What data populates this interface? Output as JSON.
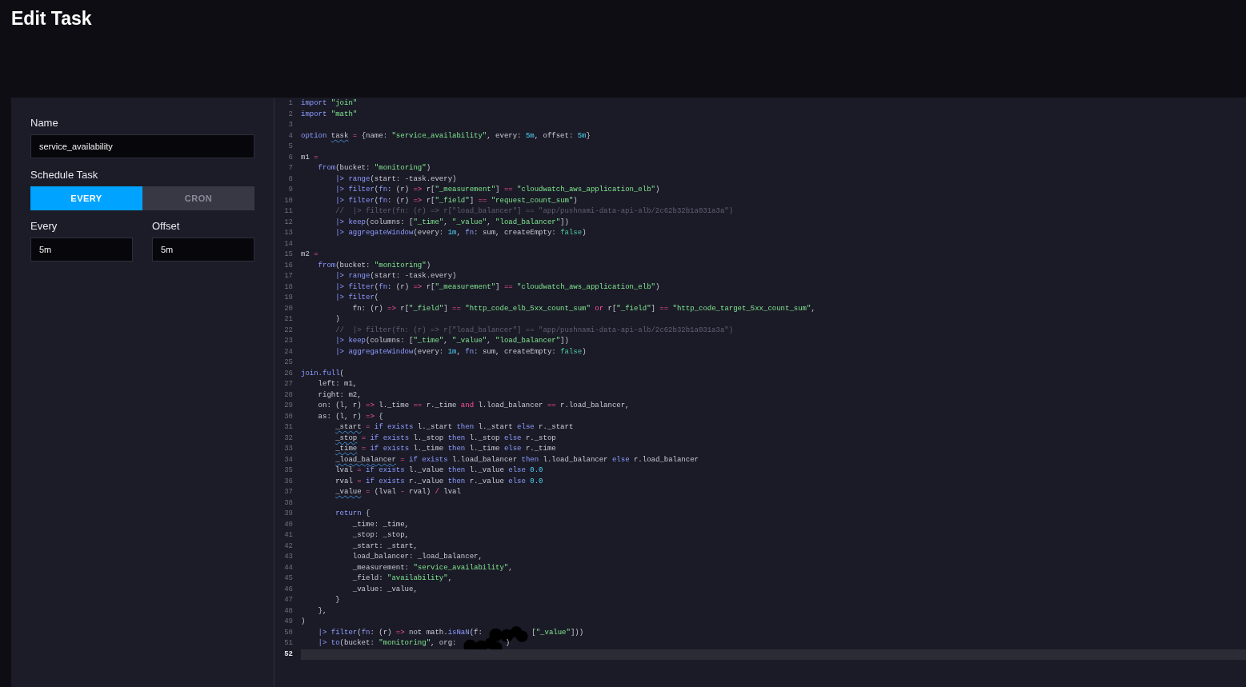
{
  "page": {
    "title": "Edit Task"
  },
  "form": {
    "name_label": "Name",
    "name_value": "service_availability",
    "schedule_label": "Schedule Task",
    "schedule_options": [
      {
        "label": "EVERY",
        "selected": true
      },
      {
        "label": "CRON",
        "selected": false
      }
    ],
    "every_label": "Every",
    "every_value": "5m",
    "offset_label": "Offset",
    "offset_value": "5m"
  },
  "editor": {
    "lines": [
      {
        "number": "1",
        "current": false,
        "tokens": [
          {
            "kind": "kw",
            "text": "import"
          },
          {
            "kind": "str",
            "text": " \"join\""
          }
        ]
      },
      {
        "number": "2",
        "current": false,
        "tokens": [
          {
            "kind": "kw",
            "text": "import"
          },
          {
            "kind": "str",
            "text": " \"math\""
          }
        ]
      },
      {
        "number": "3",
        "current": false
      },
      {
        "number": "4",
        "current": false,
        "tokens": [
          {
            "kind": "kw",
            "text": "option "
          },
          {
            "kind": "warn",
            "text": "task"
          },
          {
            "kind": "op",
            "text": " ="
          },
          {
            "kind": "plain",
            "text": " {name: "
          },
          {
            "kind": "str",
            "text": "\"service_availability\""
          },
          {
            "kind": "plain",
            "text": ", every: "
          },
          {
            "kind": "num",
            "text": "5m"
          },
          {
            "kind": "plain",
            "text": ", offset: "
          },
          {
            "kind": "num",
            "text": "5m"
          },
          {
            "kind": "plain",
            "text": "}"
          }
        ]
      },
      {
        "number": "5",
        "current": false
      },
      {
        "number": "6",
        "current": false,
        "tokens": [
          {
            "kind": "plain",
            "text": "m1 "
          },
          {
            "kind": "op",
            "text": "="
          }
        ]
      },
      {
        "number": "7",
        "current": false,
        "tokens": [
          {
            "kind": "kw",
            "text": "    from"
          },
          {
            "kind": "plain",
            "text": "(bucket: "
          },
          {
            "kind": "str",
            "text": "\"monitoring\""
          },
          {
            "kind": "plain",
            "text": ")"
          }
        ]
      },
      {
        "number": "8",
        "current": false,
        "tokens": [
          {
            "kind": "kw",
            "text": "        |> range"
          },
          {
            "kind": "plain",
            "text": "(start: -task.every)"
          }
        ]
      },
      {
        "number": "9",
        "current": false,
        "tokens": [
          {
            "kind": "kw",
            "text": "        |> filter"
          },
          {
            "kind": "plain",
            "text": "("
          },
          {
            "kind": "kw",
            "text": "fn"
          },
          {
            "kind": "plain",
            "text": ": (r) "
          },
          {
            "kind": "op",
            "text": "=>"
          },
          {
            "kind": "plain",
            "text": " r["
          },
          {
            "kind": "str",
            "text": "\"_measurement\""
          },
          {
            "kind": "plain",
            "text": "] "
          },
          {
            "kind": "op",
            "text": "=="
          },
          {
            "kind": "str",
            "text": " \"cloudwatch_aws_application_elb\""
          },
          {
            "kind": "plain",
            "text": ")"
          }
        ]
      },
      {
        "number": "10",
        "current": false,
        "tokens": [
          {
            "kind": "kw",
            "text": "        |> filter"
          },
          {
            "kind": "plain",
            "text": "("
          },
          {
            "kind": "kw",
            "text": "fn"
          },
          {
            "kind": "plain",
            "text": ": (r) "
          },
          {
            "kind": "op",
            "text": "=>"
          },
          {
            "kind": "plain",
            "text": " r["
          },
          {
            "kind": "str",
            "text": "\"_field\""
          },
          {
            "kind": "plain",
            "text": "] "
          },
          {
            "kind": "op",
            "text": "=="
          },
          {
            "kind": "str",
            "text": " \"request_count_sum\""
          },
          {
            "kind": "plain",
            "text": ")"
          }
        ]
      },
      {
        "number": "11",
        "current": false,
        "tokens": [
          {
            "kind": "comment",
            "text": "        //  |> filter(fn: (r) => r[\"load_balancer\"] == \"app/pushnami-data-api-alb/2c62b32b1a031a3a\")"
          }
        ]
      },
      {
        "number": "12",
        "current": false,
        "tokens": [
          {
            "kind": "kw",
            "text": "        |> keep"
          },
          {
            "kind": "plain",
            "text": "(columns: ["
          },
          {
            "kind": "str",
            "text": "\"_time\""
          },
          {
            "kind": "plain",
            "text": ", "
          },
          {
            "kind": "str",
            "text": "\"_value\""
          },
          {
            "kind": "plain",
            "text": ", "
          },
          {
            "kind": "str",
            "text": "\"load_balancer\""
          },
          {
            "kind": "plain",
            "text": "])"
          }
        ]
      },
      {
        "number": "13",
        "current": false,
        "tokens": [
          {
            "kind": "kw",
            "text": "        |> aggregateWindow"
          },
          {
            "kind": "plain",
            "text": "(every: "
          },
          {
            "kind": "num",
            "text": "1m"
          },
          {
            "kind": "plain",
            "text": ", "
          },
          {
            "kind": "kw",
            "text": "fn"
          },
          {
            "kind": "plain",
            "text": ": sum, createEmpty: "
          },
          {
            "kind": "bool",
            "text": "false"
          },
          {
            "kind": "plain",
            "text": ")"
          }
        ]
      },
      {
        "number": "14",
        "current": false
      },
      {
        "number": "15",
        "current": false,
        "tokens": [
          {
            "kind": "plain",
            "text": "m2 "
          },
          {
            "kind": "op",
            "text": "="
          }
        ]
      },
      {
        "number": "16",
        "current": false,
        "tokens": [
          {
            "kind": "kw",
            "text": "    from"
          },
          {
            "kind": "plain",
            "text": "(bucket: "
          },
          {
            "kind": "str",
            "text": "\"monitoring\""
          },
          {
            "kind": "plain",
            "text": ")"
          }
        ]
      },
      {
        "number": "17",
        "current": false,
        "tokens": [
          {
            "kind": "kw",
            "text": "        |> range"
          },
          {
            "kind": "plain",
            "text": "(start: -task.every)"
          }
        ]
      },
      {
        "number": "18",
        "current": false,
        "tokens": [
          {
            "kind": "kw",
            "text": "        |> filter"
          },
          {
            "kind": "plain",
            "text": "("
          },
          {
            "kind": "kw",
            "text": "fn"
          },
          {
            "kind": "plain",
            "text": ": (r) "
          },
          {
            "kind": "op",
            "text": "=>"
          },
          {
            "kind": "plain",
            "text": " r["
          },
          {
            "kind": "str",
            "text": "\"_measurement\""
          },
          {
            "kind": "plain",
            "text": "] "
          },
          {
            "kind": "op",
            "text": "=="
          },
          {
            "kind": "str",
            "text": " \"cloudwatch_aws_application_elb\""
          },
          {
            "kind": "plain",
            "text": ")"
          }
        ]
      },
      {
        "number": "19",
        "current": false,
        "tokens": [
          {
            "kind": "kw",
            "text": "        |> filter"
          },
          {
            "kind": "plain",
            "text": "("
          }
        ]
      },
      {
        "number": "20",
        "current": false,
        "tokens": [
          {
            "kind": "plain",
            "text": "            fn: (r) "
          },
          {
            "kind": "op",
            "text": "=>"
          },
          {
            "kind": "plain",
            "text": " r["
          },
          {
            "kind": "str",
            "text": "\"_field\""
          },
          {
            "kind": "plain",
            "text": "] "
          },
          {
            "kind": "op",
            "text": "=="
          },
          {
            "kind": "str",
            "text": " \"http_code_elb_5xx_count_sum\""
          },
          {
            "kind": "op",
            "text": " or"
          },
          {
            "kind": "plain",
            "text": " r["
          },
          {
            "kind": "str",
            "text": "\"_field\""
          },
          {
            "kind": "plain",
            "text": "] "
          },
          {
            "kind": "op",
            "text": "=="
          },
          {
            "kind": "str",
            "text": " \"http_code_target_5xx_count_sum\""
          },
          {
            "kind": "plain",
            "text": ","
          }
        ]
      },
      {
        "number": "21",
        "current": false,
        "tokens": [
          {
            "kind": "plain",
            "text": "        )"
          }
        ]
      },
      {
        "number": "22",
        "current": false,
        "tokens": [
          {
            "kind": "comment",
            "text": "        //  |> filter(fn: (r) => r[\"load_balancer\"] == \"app/pushnami-data-api-alb/2c62b32b1a031a3a\")"
          }
        ]
      },
      {
        "number": "23",
        "current": false,
        "tokens": [
          {
            "kind": "kw",
            "text": "        |> keep"
          },
          {
            "kind": "plain",
            "text": "(columns: ["
          },
          {
            "kind": "str",
            "text": "\"_time\""
          },
          {
            "kind": "plain",
            "text": ", "
          },
          {
            "kind": "str",
            "text": "\"_value\""
          },
          {
            "kind": "plain",
            "text": ", "
          },
          {
            "kind": "str",
            "text": "\"load_balancer\""
          },
          {
            "kind": "plain",
            "text": "])"
          }
        ]
      },
      {
        "number": "24",
        "current": false,
        "tokens": [
          {
            "kind": "kw",
            "text": "        |> aggregateWindow"
          },
          {
            "kind": "plain",
            "text": "(every: "
          },
          {
            "kind": "num",
            "text": "1m"
          },
          {
            "kind": "plain",
            "text": ", "
          },
          {
            "kind": "kw",
            "text": "fn"
          },
          {
            "kind": "plain",
            "text": ": sum, createEmpty: "
          },
          {
            "kind": "bool",
            "text": "false"
          },
          {
            "kind": "plain",
            "text": ")"
          }
        ]
      },
      {
        "number": "25",
        "current": false
      },
      {
        "number": "26",
        "current": false,
        "tokens": [
          {
            "kind": "kw",
            "text": "join.full"
          },
          {
            "kind": "plain",
            "text": "("
          }
        ]
      },
      {
        "number": "27",
        "current": false,
        "tokens": [
          {
            "kind": "plain",
            "text": "    left: m1,"
          }
        ]
      },
      {
        "number": "28",
        "current": false,
        "tokens": [
          {
            "kind": "plain",
            "text": "    right: m2,"
          }
        ]
      },
      {
        "number": "29",
        "current": false,
        "tokens": [
          {
            "kind": "plain",
            "text": "    on: (l, r) "
          },
          {
            "kind": "op",
            "text": "=>"
          },
          {
            "kind": "plain",
            "text": " l._time "
          },
          {
            "kind": "op",
            "text": "=="
          },
          {
            "kind": "plain",
            "text": " r._time "
          },
          {
            "kind": "op",
            "text": "and"
          },
          {
            "kind": "plain",
            "text": " l.load_balancer "
          },
          {
            "kind": "op",
            "text": "=="
          },
          {
            "kind": "plain",
            "text": " r.load_balancer,"
          }
        ]
      },
      {
        "number": "30",
        "current": false,
        "tokens": [
          {
            "kind": "plain",
            "text": "    as: (l, r) "
          },
          {
            "kind": "op",
            "text": "=>"
          },
          {
            "kind": "plain",
            "text": " {"
          }
        ]
      },
      {
        "number": "31",
        "current": false,
        "tokens": [
          {
            "kind": "warn",
            "text": "        _start"
          },
          {
            "kind": "op",
            "text": " ="
          },
          {
            "kind": "kw",
            "text": " if exists"
          },
          {
            "kind": "plain",
            "text": " l._start "
          },
          {
            "kind": "kw",
            "text": "then"
          },
          {
            "kind": "plain",
            "text": " l._start "
          },
          {
            "kind": "kw",
            "text": "else"
          },
          {
            "kind": "plain",
            "text": " r._start"
          }
        ]
      },
      {
        "number": "32",
        "current": false,
        "tokens": [
          {
            "kind": "warn",
            "text": "        _stop"
          },
          {
            "kind": "op",
            "text": " ="
          },
          {
            "kind": "kw",
            "text": " if exists"
          },
          {
            "kind": "plain",
            "text": " l._stop "
          },
          {
            "kind": "kw",
            "text": "then"
          },
          {
            "kind": "plain",
            "text": " l._stop "
          },
          {
            "kind": "kw",
            "text": "else"
          },
          {
            "kind": "plain",
            "text": " r._stop"
          }
        ]
      },
      {
        "number": "33",
        "current": false,
        "tokens": [
          {
            "kind": "warn",
            "text": "        _time"
          },
          {
            "kind": "op",
            "text": " ="
          },
          {
            "kind": "kw",
            "text": " if exists"
          },
          {
            "kind": "plain",
            "text": " l._time "
          },
          {
            "kind": "kw",
            "text": "then"
          },
          {
            "kind": "plain",
            "text": " l._time "
          },
          {
            "kind": "kw",
            "text": "else"
          },
          {
            "kind": "plain",
            "text": " r._time"
          }
        ]
      },
      {
        "number": "34",
        "current": false,
        "tokens": [
          {
            "kind": "warn",
            "text": "        _load_balancer"
          },
          {
            "kind": "op",
            "text": " ="
          },
          {
            "kind": "kw",
            "text": " if exists"
          },
          {
            "kind": "plain",
            "text": " l.load_balancer "
          },
          {
            "kind": "kw",
            "text": "then"
          },
          {
            "kind": "plain",
            "text": " l.load_balancer "
          },
          {
            "kind": "kw",
            "text": "else"
          },
          {
            "kind": "plain",
            "text": " r.load_balancer"
          }
        ]
      },
      {
        "number": "35",
        "current": false,
        "tokens": [
          {
            "kind": "plain",
            "text": "        lval "
          },
          {
            "kind": "op",
            "text": "="
          },
          {
            "kind": "kw",
            "text": " if exists"
          },
          {
            "kind": "plain",
            "text": " l._value "
          },
          {
            "kind": "kw",
            "text": "then"
          },
          {
            "kind": "plain",
            "text": " l._value "
          },
          {
            "kind": "kw",
            "text": "else"
          },
          {
            "kind": "num",
            "text": " 0.0"
          }
        ]
      },
      {
        "number": "36",
        "current": false,
        "tokens": [
          {
            "kind": "plain",
            "text": "        rval "
          },
          {
            "kind": "op",
            "text": "="
          },
          {
            "kind": "kw",
            "text": " if exists"
          },
          {
            "kind": "plain",
            "text": " r._value "
          },
          {
            "kind": "kw",
            "text": "then"
          },
          {
            "kind": "plain",
            "text": " r._value "
          },
          {
            "kind": "kw",
            "text": "else"
          },
          {
            "kind": "num",
            "text": " 0.0"
          }
        ]
      },
      {
        "number": "37",
        "current": false,
        "tokens": [
          {
            "kind": "warn",
            "text": "        _value"
          },
          {
            "kind": "op",
            "text": " ="
          },
          {
            "kind": "plain",
            "text": " (lval "
          },
          {
            "kind": "op",
            "text": "-"
          },
          {
            "kind": "plain",
            "text": " rval) "
          },
          {
            "kind": "op",
            "text": "/"
          },
          {
            "kind": "plain",
            "text": " lval"
          }
        ]
      },
      {
        "number": "38",
        "current": false
      },
      {
        "number": "39",
        "current": false,
        "tokens": [
          {
            "kind": "kw",
            "text": "        return"
          },
          {
            "kind": "plain",
            "text": " {"
          }
        ]
      },
      {
        "number": "40",
        "current": false,
        "tokens": [
          {
            "kind": "plain",
            "text": "            _time: _time,"
          }
        ]
      },
      {
        "number": "41",
        "current": false,
        "tokens": [
          {
            "kind": "plain",
            "text": "            _stop: _stop,"
          }
        ]
      },
      {
        "number": "42",
        "current": false,
        "tokens": [
          {
            "kind": "plain",
            "text": "            _start: _start,"
          }
        ]
      },
      {
        "number": "43",
        "current": false,
        "tokens": [
          {
            "kind": "plain",
            "text": "            load_balancer: _load_balancer,"
          }
        ]
      },
      {
        "number": "44",
        "current": false,
        "tokens": [
          {
            "kind": "plain",
            "text": "            _measurement: "
          },
          {
            "kind": "str",
            "text": "\"service_availability\""
          },
          {
            "kind": "plain",
            "text": ","
          }
        ]
      },
      {
        "number": "45",
        "current": false,
        "tokens": [
          {
            "kind": "plain",
            "text": "            _field: "
          },
          {
            "kind": "str",
            "text": "\"availability\""
          },
          {
            "kind": "plain",
            "text": ","
          }
        ]
      },
      {
        "number": "46",
        "current": false,
        "tokens": [
          {
            "kind": "plain",
            "text": "            _value: _value,"
          }
        ]
      },
      {
        "number": "47",
        "current": false,
        "tokens": [
          {
            "kind": "plain",
            "text": "        }"
          }
        ]
      },
      {
        "number": "48",
        "current": false,
        "tokens": [
          {
            "kind": "plain",
            "text": "    },"
          }
        ]
      },
      {
        "number": "49",
        "current": false,
        "tokens": [
          {
            "kind": "plain",
            "text": ")"
          }
        ]
      },
      {
        "number": "50",
        "current": false,
        "tokens": [
          {
            "kind": "kw",
            "text": "    |> filter"
          },
          {
            "kind": "plain",
            "text": "("
          },
          {
            "kind": "kw",
            "text": "fn"
          },
          {
            "kind": "plain",
            "text": ": (r) "
          },
          {
            "kind": "op",
            "text": "=>"
          },
          {
            "kind": "plain",
            "text": " not math."
          },
          {
            "kind": "kw",
            "text": "isNaN"
          },
          {
            "kind": "plain",
            "text": "(f: "
          },
          {
            "kind": "redacted"
          },
          {
            "kind": "plain",
            "text": "["
          },
          {
            "kind": "str",
            "text": "\"_value\""
          },
          {
            "kind": "plain",
            "text": "]))"
          }
        ]
      },
      {
        "number": "51",
        "current": false,
        "tokens": [
          {
            "kind": "kw",
            "text": "    |> to"
          },
          {
            "kind": "plain",
            "text": "(bucket: "
          },
          {
            "kind": "str",
            "text": "\"monitoring\""
          },
          {
            "kind": "plain",
            "text": ", org: "
          },
          {
            "kind": "redacted"
          },
          {
            "kind": "plain",
            "text": ")"
          }
        ]
      },
      {
        "number": "52",
        "current": true
      }
    ]
  }
}
